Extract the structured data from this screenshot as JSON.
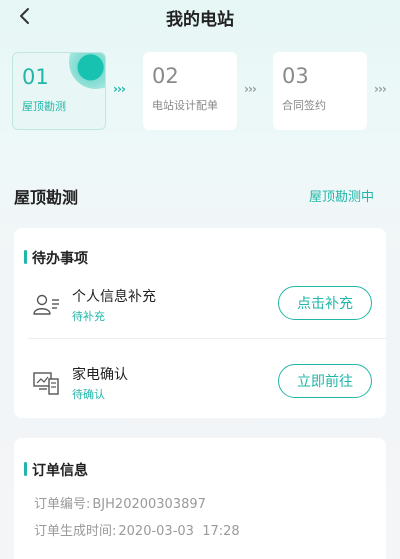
{
  "header": {
    "title": "我的电站",
    "back_icon": "chevron-left-icon"
  },
  "steps": [
    {
      "num": "01",
      "label": "屋顶勘测",
      "active": true
    },
    {
      "num": "02",
      "label": "电站设计配单",
      "active": false
    },
    {
      "num": "03",
      "label": "合同签约",
      "active": false
    }
  ],
  "step_separator": "›››",
  "section": {
    "title": "屋顶勘测",
    "status": "屋顶勘测中"
  },
  "todo_card": {
    "title": "待办事项",
    "items": [
      {
        "title": "个人信息补充",
        "status": "待补充",
        "button": "点击补充",
        "icon": "person-info-icon"
      },
      {
        "title": "家电确认",
        "status": "待确认",
        "button": "立即前往",
        "icon": "appliance-icon"
      }
    ]
  },
  "order_card": {
    "title": "订单信息",
    "order_no_label": "订单编号:",
    "order_no": "BJH20200303897",
    "created_label": "订单生成时间:",
    "created": "2020-03-03  17:28"
  },
  "colors": {
    "accent": "#21b6a8",
    "arrow_active": "#21b6a8",
    "arrow_inactive": "#9a9a9a"
  }
}
